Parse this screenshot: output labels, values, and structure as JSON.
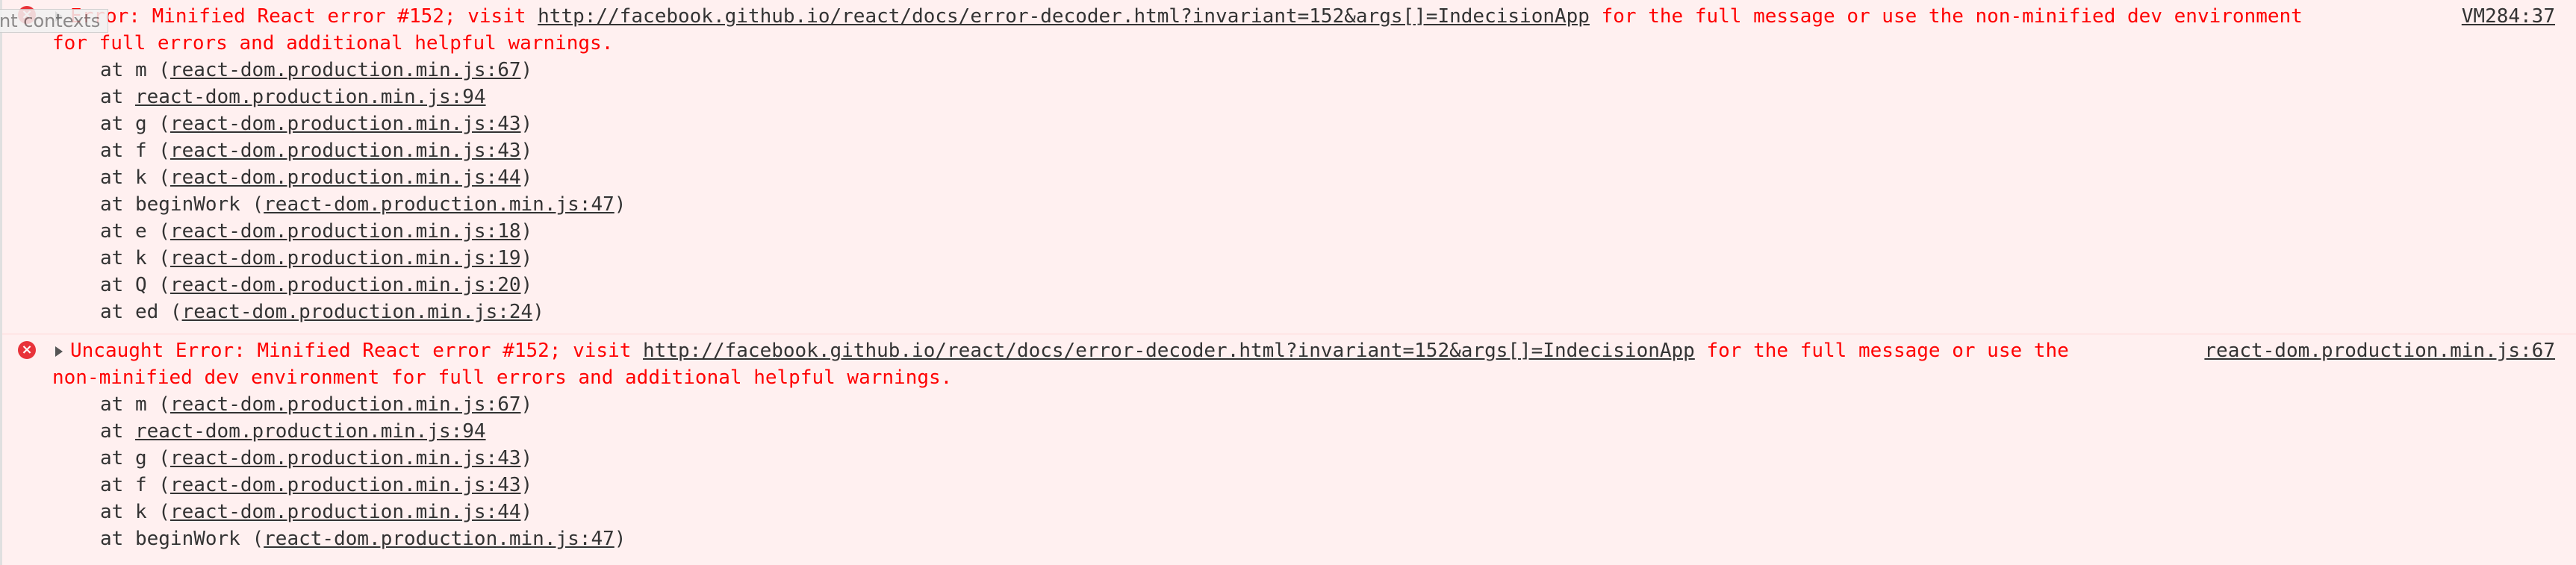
{
  "tooltip": {
    "text": "nt contexts"
  },
  "messages": [
    {
      "icon": "error-circle-icon",
      "prefix": "Error",
      "text_before_url": ": Minified React error #152; visit ",
      "url": "http://facebook.github.io/react/docs/error-decoder.html?invariant=152&args[]=IndecisionApp",
      "text_after_url": " for the full message or use the non-minified dev environment",
      "continuation": "for full errors and additional helpful warnings.",
      "source": "VM284:37",
      "stack": [
        {
          "prefix": "at m (",
          "file": "react-dom.production.min.js:67",
          "suffix": ")"
        },
        {
          "prefix": "at ",
          "file": "react-dom.production.min.js:94",
          "suffix": ""
        },
        {
          "prefix": "at g (",
          "file": "react-dom.production.min.js:43",
          "suffix": ")"
        },
        {
          "prefix": "at f (",
          "file": "react-dom.production.min.js:43",
          "suffix": ")"
        },
        {
          "prefix": "at k (",
          "file": "react-dom.production.min.js:44",
          "suffix": ")"
        },
        {
          "prefix": "at beginWork (",
          "file": "react-dom.production.min.js:47",
          "suffix": ")"
        },
        {
          "prefix": "at e (",
          "file": "react-dom.production.min.js:18",
          "suffix": ")"
        },
        {
          "prefix": "at k (",
          "file": "react-dom.production.min.js:19",
          "suffix": ")"
        },
        {
          "prefix": "at Q (",
          "file": "react-dom.production.min.js:20",
          "suffix": ")"
        },
        {
          "prefix": "at ed (",
          "file": "react-dom.production.min.js:24",
          "suffix": ")"
        }
      ]
    },
    {
      "icon": "error-circle-icon",
      "prefix": "Uncaught Error",
      "text_before_url": ": Minified React error #152; visit ",
      "url": "http://facebook.github.io/react/docs/error-decoder.html?invariant=152&args[]=IndecisionApp",
      "text_after_url": " for the full message or use the ",
      "continuation": "non-minified dev environment for full errors and additional helpful warnings.",
      "source": "react-dom.production.min.js:67",
      "stack": [
        {
          "prefix": "at m (",
          "file": "react-dom.production.min.js:67",
          "suffix": ")"
        },
        {
          "prefix": "at ",
          "file": "react-dom.production.min.js:94",
          "suffix": ""
        },
        {
          "prefix": "at g (",
          "file": "react-dom.production.min.js:43",
          "suffix": ")"
        },
        {
          "prefix": "at f (",
          "file": "react-dom.production.min.js:43",
          "suffix": ")"
        },
        {
          "prefix": "at k (",
          "file": "react-dom.production.min.js:44",
          "suffix": ")"
        },
        {
          "prefix": "at beginWork (",
          "file": "react-dom.production.min.js:47",
          "suffix": ")"
        }
      ]
    }
  ],
  "colors": {
    "background": "#fff0f0",
    "error_text": "#ff0000",
    "stack_text": "#333333",
    "icon": "#e8333a"
  }
}
